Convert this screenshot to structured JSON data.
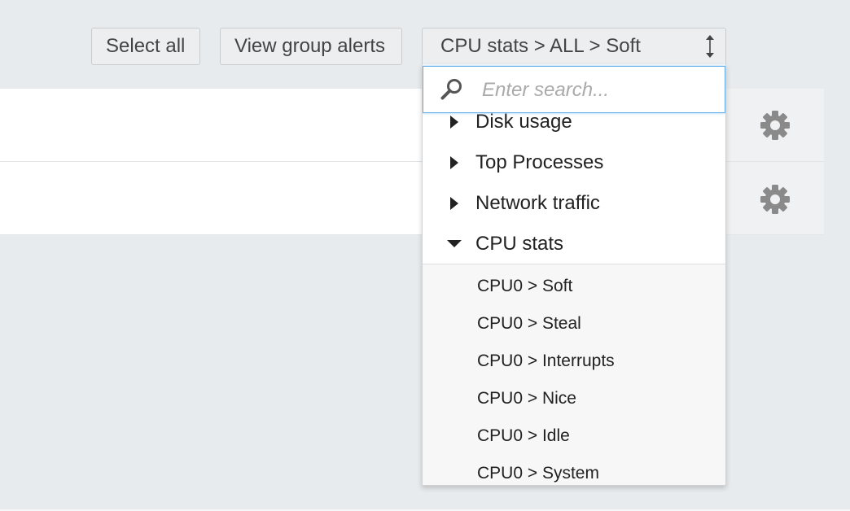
{
  "toolbar": {
    "select_all_label": "Select all",
    "view_group_alerts_label": "View group alerts",
    "dropdown_selected": "CPU stats > ALL > Soft",
    "dropdown_icon": "sort-arrows-icon"
  },
  "rows": [
    {
      "action_icon": "gear-icon"
    },
    {
      "action_icon": "gear-icon"
    }
  ],
  "dropdown": {
    "search": {
      "placeholder": "Enter search...",
      "value": "",
      "icon": "search-icon"
    },
    "categories": [
      {
        "label": "Disk usage",
        "expanded": false
      },
      {
        "label": "Top Processes",
        "expanded": false
      },
      {
        "label": "Network traffic",
        "expanded": false
      },
      {
        "label": "CPU stats",
        "expanded": true
      }
    ],
    "cpu_items": [
      {
        "label": "CPU0 > Soft"
      },
      {
        "label": "CPU0 > Steal"
      },
      {
        "label": "CPU0 > Interrupts"
      },
      {
        "label": "CPU0 > Nice"
      },
      {
        "label": "CPU0 > Idle"
      },
      {
        "label": "CPU0 > System"
      }
    ]
  },
  "colors": {
    "page_bg": "#e8ebed",
    "focus_border": "#66afe9",
    "icon_gray": "#8a8a8a"
  }
}
